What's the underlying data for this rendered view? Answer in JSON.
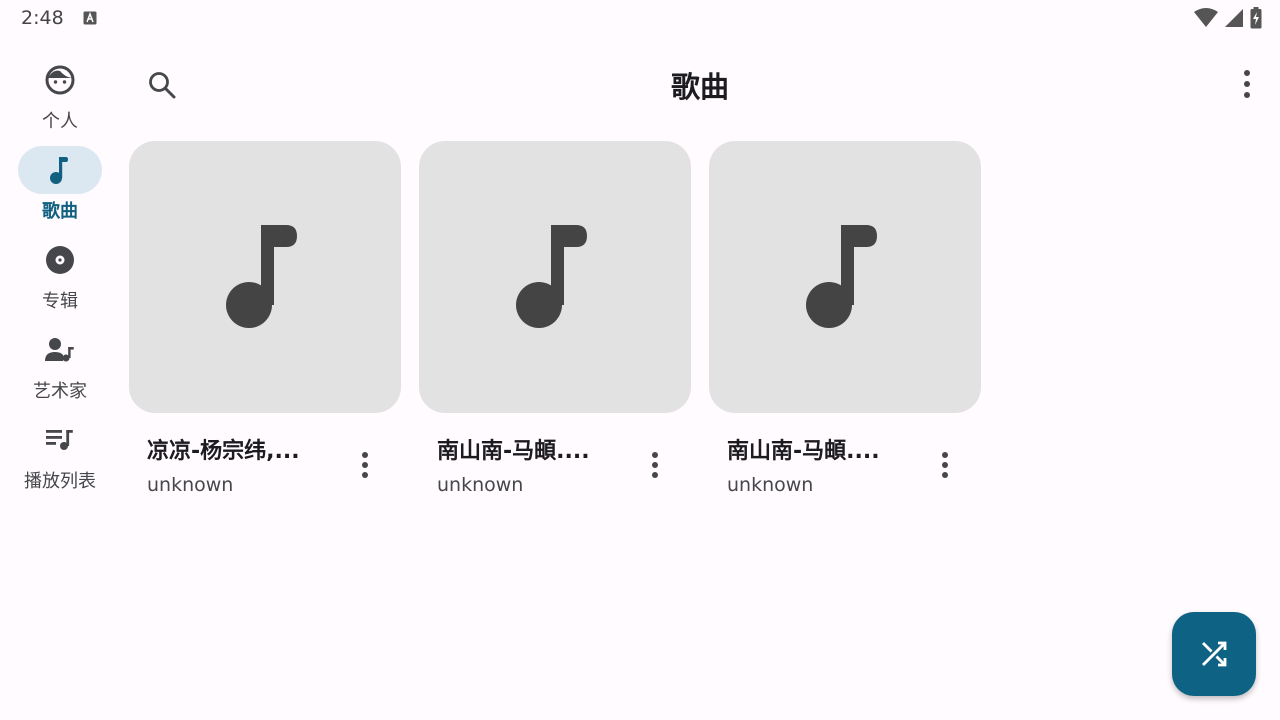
{
  "status_bar": {
    "time": "2:48",
    "icons": [
      "text-a-icon",
      "wifi-icon",
      "signal-icon",
      "battery-charging-icon"
    ]
  },
  "nav": {
    "items": [
      {
        "label": "个人",
        "icon": "face-icon",
        "active": false
      },
      {
        "label": "歌曲",
        "icon": "music-note-icon",
        "active": true
      },
      {
        "label": "专辑",
        "icon": "album-icon",
        "active": false
      },
      {
        "label": "艺术家",
        "icon": "artist-icon",
        "active": false
      },
      {
        "label": "播放列表",
        "icon": "playlist-icon",
        "active": false
      }
    ]
  },
  "header": {
    "title": "歌曲",
    "search_icon": "search-icon",
    "more_icon": "more-vert-icon"
  },
  "songs": [
    {
      "title": "凉凉-杨宗纬,...",
      "artist": "unknown"
    },
    {
      "title": "南山南-马頔....",
      "artist": "unknown"
    },
    {
      "title": "南山南-马頔....",
      "artist": "unknown"
    }
  ],
  "fab": {
    "icon": "shuffle-icon"
  },
  "colors": {
    "accent": "#116080",
    "fab": "#0e6384",
    "nav_active_bg": "#dbe8f2",
    "card_bg": "#e2e2e2",
    "background": "#fffbfe"
  }
}
